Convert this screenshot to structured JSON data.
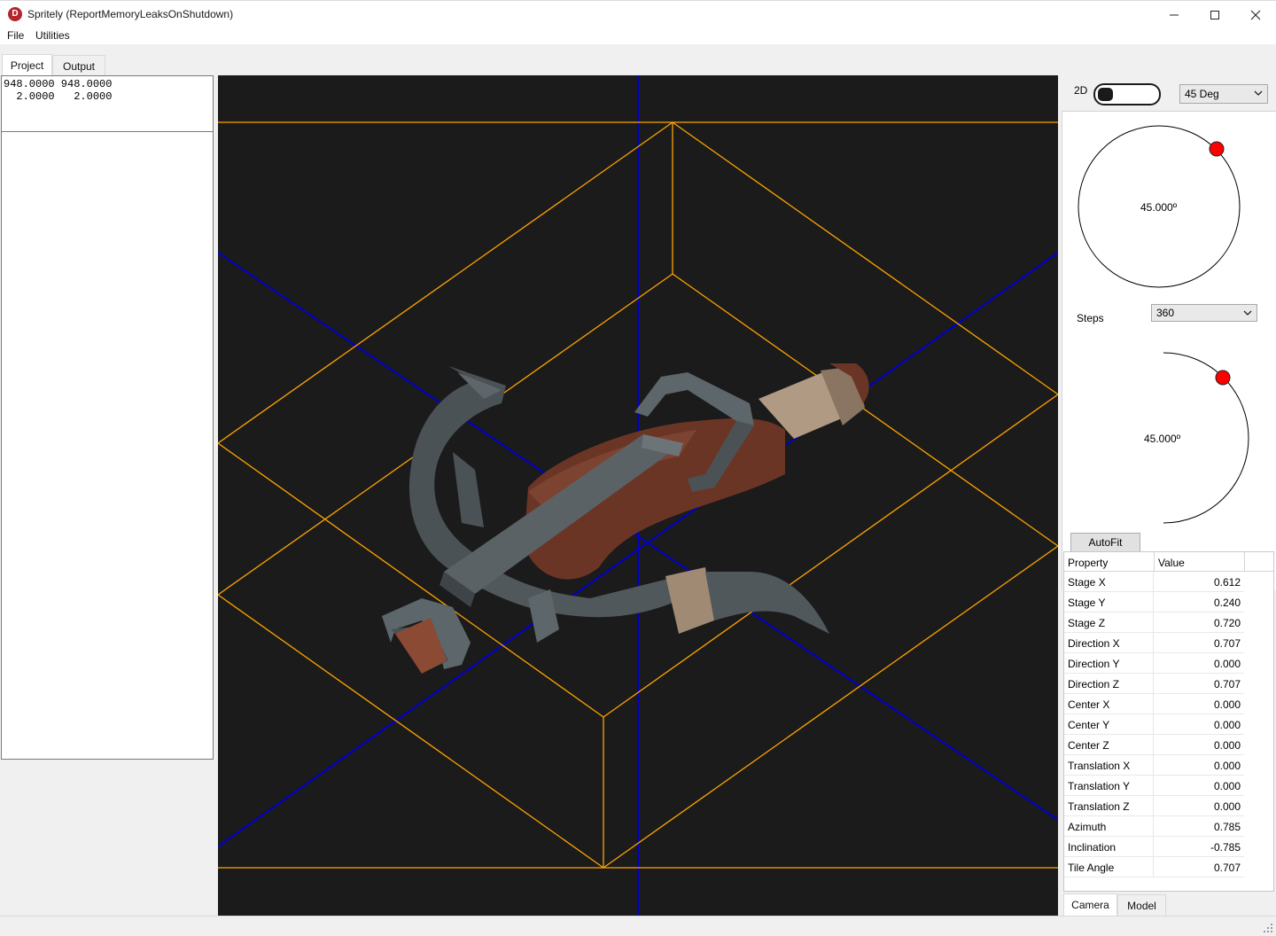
{
  "window": {
    "title": "Spritely (ReportMemoryLeaksOnShutdown)",
    "icon_letter": "D",
    "icon_color": "#b3262e"
  },
  "menu": {
    "file": "File",
    "utilities": "Utilities"
  },
  "left_tabs": {
    "project": "Project",
    "output": "Output"
  },
  "left_text": "948.0000 948.0000\n  2.0000   2.0000",
  "viewport": {
    "background": "#1b1b1b",
    "bbox_color": "#ffa500",
    "axis_color": "#0000cd",
    "model": "crossbow"
  },
  "right_panel": {
    "label_2d": "2D",
    "angle_select": "45 Deg",
    "dial1_text": "45.000º",
    "steps_label": "Steps",
    "steps_select": "360",
    "dial2_text": "45.000º",
    "autofit": "AutoFit"
  },
  "properties": {
    "header_property": "Property",
    "header_value": "Value",
    "rows": [
      {
        "name": "Stage X",
        "value": "0.612"
      },
      {
        "name": "Stage Y",
        "value": "0.240"
      },
      {
        "name": "Stage Z",
        "value": "0.720"
      },
      {
        "name": "Direction X",
        "value": "0.707"
      },
      {
        "name": "Direction Y",
        "value": "0.000"
      },
      {
        "name": "Direction Z",
        "value": "0.707"
      },
      {
        "name": "Center X",
        "value": "0.000"
      },
      {
        "name": "Center Y",
        "value": "0.000"
      },
      {
        "name": "Center Z",
        "value": "0.000"
      },
      {
        "name": "Translation X",
        "value": "0.000"
      },
      {
        "name": "Translation Y",
        "value": "0.000"
      },
      {
        "name": "Translation Z",
        "value": "0.000"
      },
      {
        "name": "Azimuth",
        "value": "0.785"
      },
      {
        "name": "Inclination",
        "value": "-0.785"
      },
      {
        "name": "Tile Angle",
        "value": "0.707"
      }
    ]
  },
  "bottom_tabs": {
    "camera": "Camera",
    "model": "Model"
  },
  "colors": {
    "dial_handle": "#ff0000"
  }
}
